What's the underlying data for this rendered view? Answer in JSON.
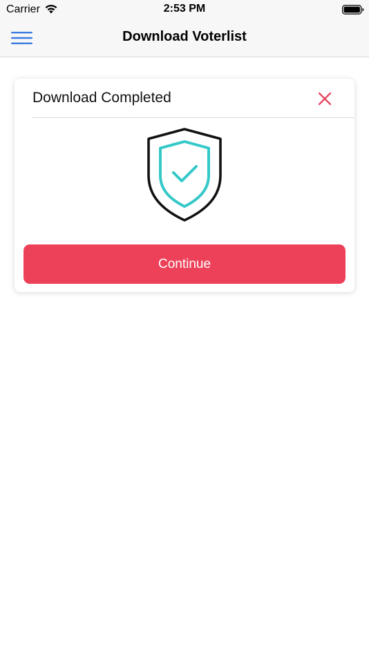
{
  "status_bar": {
    "carrier": "Carrier",
    "time": "2:53 PM",
    "wifi_icon": "wifi-icon",
    "battery_icon": "battery-icon"
  },
  "nav": {
    "title": "Download Voterlist",
    "menu_icon": "hamburger-menu-icon"
  },
  "dialog": {
    "title": "Download Completed",
    "close_icon": "close-icon",
    "illustration_icon": "shield-check-icon",
    "continue_label": "Continue"
  },
  "colors": {
    "accent_blue": "#3a7be0",
    "button_red": "#ed4159",
    "close_red": "#e8465f",
    "shield_teal": "#35c8c8",
    "shield_outline": "#111111"
  }
}
